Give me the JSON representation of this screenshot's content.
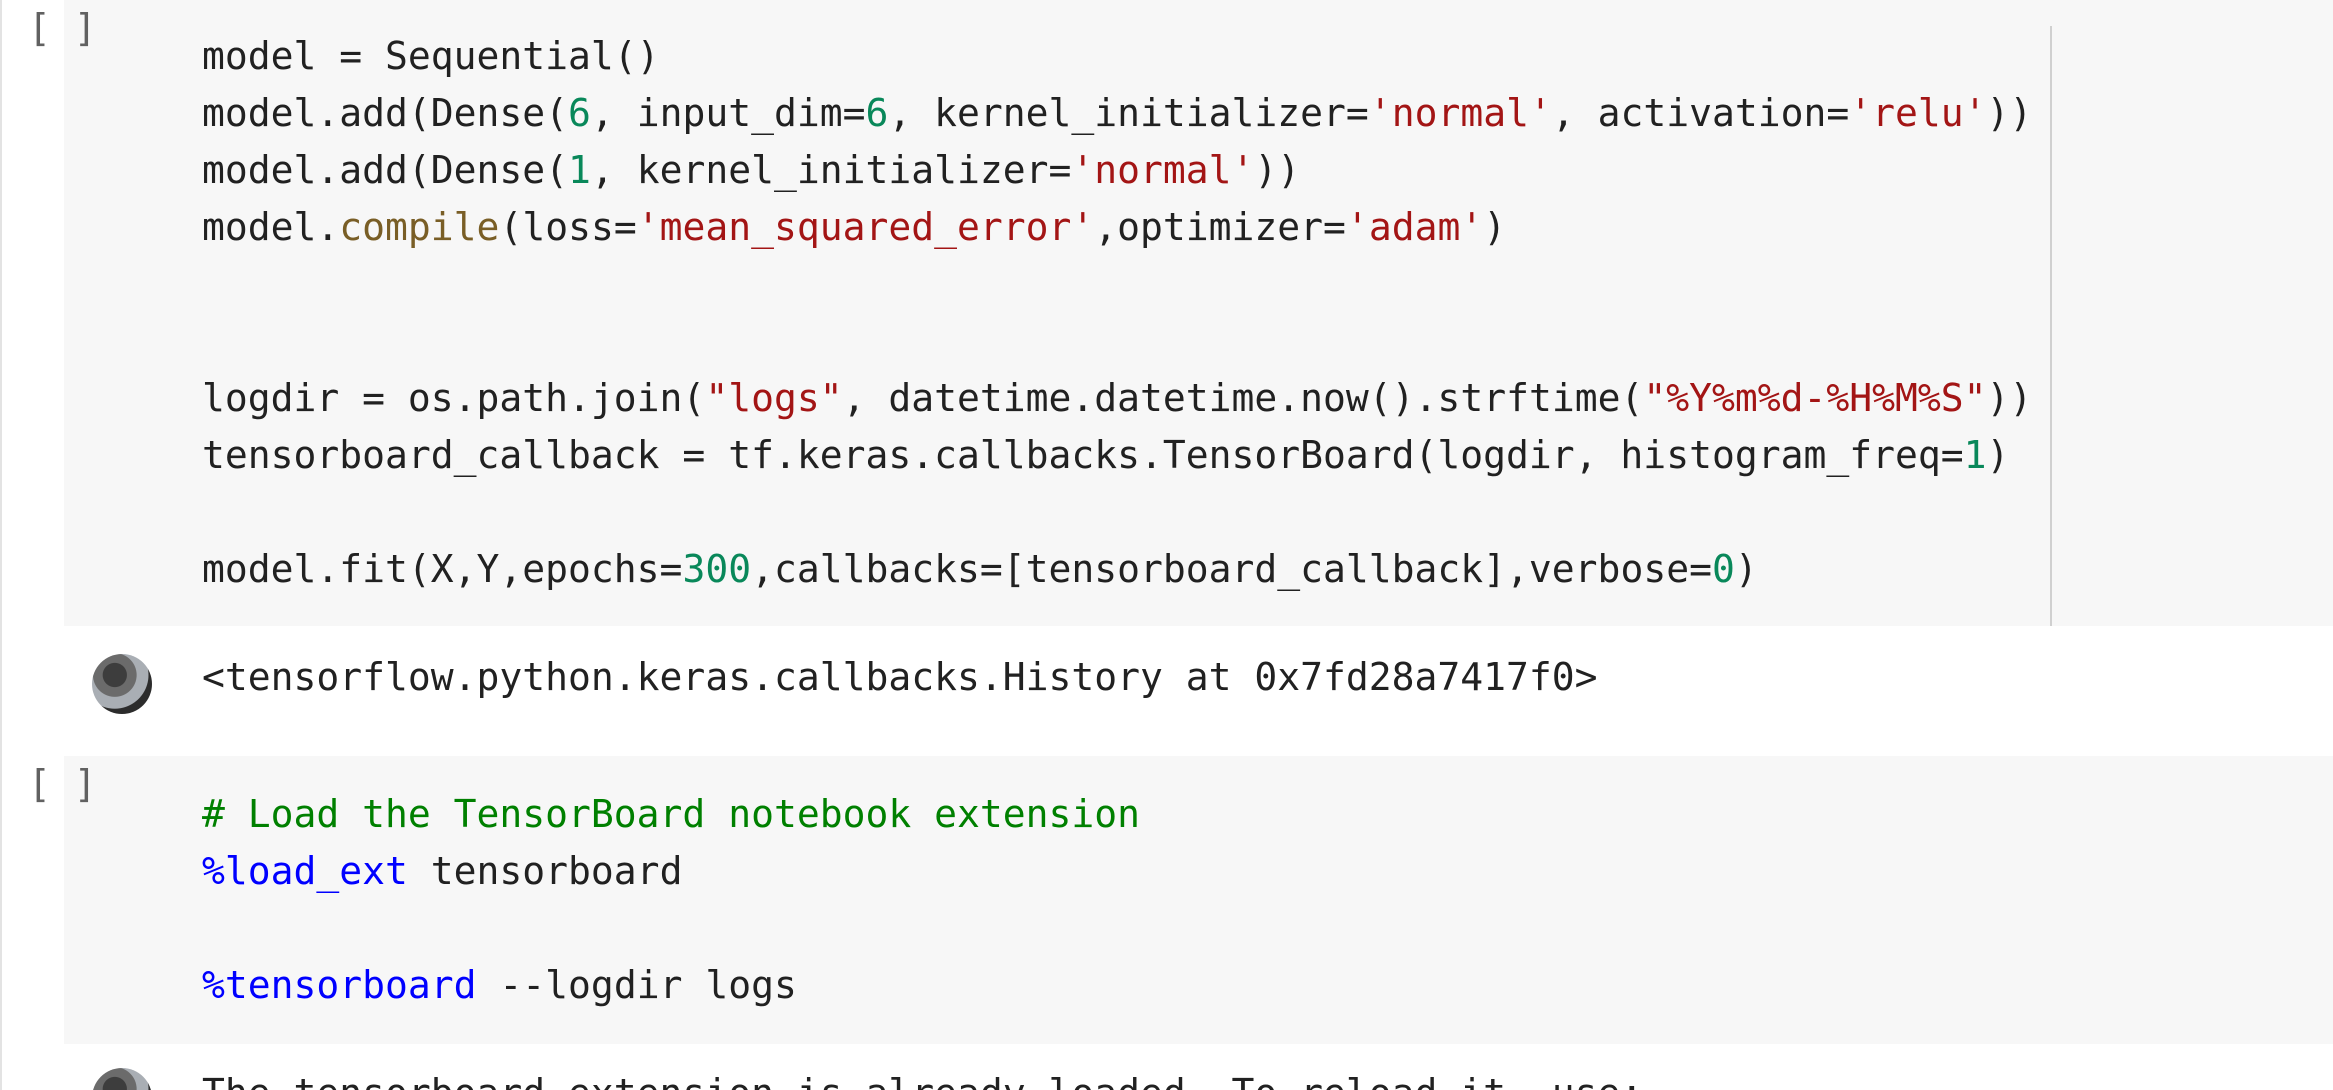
{
  "left_rule": true,
  "cells": [
    {
      "run_label": "[ ]",
      "lines": [
        [
          {
            "text": "model = Sequential()",
            "kind": "default"
          }
        ],
        [
          {
            "text": "model.add(Dense(",
            "kind": "default"
          },
          {
            "text": "6",
            "kind": "number"
          },
          {
            "text": ", input_dim=",
            "kind": "default"
          },
          {
            "text": "6",
            "kind": "number"
          },
          {
            "text": ", kernel_initializer=",
            "kind": "default"
          },
          {
            "text": "'normal'",
            "kind": "string"
          },
          {
            "text": ", activation=",
            "kind": "default"
          },
          {
            "text": "'relu'",
            "kind": "string"
          },
          {
            "text": "))",
            "kind": "default"
          }
        ],
        [
          {
            "text": "model.add(Dense(",
            "kind": "default"
          },
          {
            "text": "1",
            "kind": "number"
          },
          {
            "text": ", kernel_initializer=",
            "kind": "default"
          },
          {
            "text": "'normal'",
            "kind": "string"
          },
          {
            "text": "))",
            "kind": "default"
          }
        ],
        [
          {
            "text": "model.",
            "kind": "default"
          },
          {
            "text": "compile",
            "kind": "builtin"
          },
          {
            "text": "(loss=",
            "kind": "default"
          },
          {
            "text": "'mean_squared_error'",
            "kind": "string"
          },
          {
            "text": ",optimizer=",
            "kind": "default"
          },
          {
            "text": "'adam'",
            "kind": "string"
          },
          {
            "text": ")",
            "kind": "default"
          }
        ],
        [],
        [],
        [
          {
            "text": "logdir = os.path.join(",
            "kind": "default"
          },
          {
            "text": "\"logs\"",
            "kind": "string"
          },
          {
            "text": ", datetime.datetime.now().strftime(",
            "kind": "default"
          },
          {
            "text": "\"%Y%m%d-%H%M%S\"",
            "kind": "string"
          },
          {
            "text": "))",
            "kind": "default"
          }
        ],
        [
          {
            "text": "tensorboard_callback = tf.keras.callbacks.TensorBoard(logdir, histogram_freq=",
            "kind": "default"
          },
          {
            "text": "1",
            "kind": "number"
          },
          {
            "text": ")",
            "kind": "default"
          }
        ],
        [],
        [
          {
            "text": "model.fit(X,Y,epochs=",
            "kind": "default"
          },
          {
            "text": "300",
            "kind": "number"
          },
          {
            "text": ",callbacks=[tensorboard_callback],verbose=",
            "kind": "default"
          },
          {
            "text": "0",
            "kind": "number"
          },
          {
            "text": ")",
            "kind": "default"
          }
        ]
      ],
      "output": "<tensorflow.python.keras.callbacks.History at 0x7fd28a7417f0>"
    },
    {
      "run_label": "[ ]",
      "lines": [
        [
          {
            "text": "# Load the TensorBoard notebook extension",
            "kind": "comment"
          }
        ],
        [
          {
            "text": "%load_ext",
            "kind": "magic"
          },
          {
            "text": " tensorboard",
            "kind": "default"
          }
        ],
        [],
        [
          {
            "text": "%tensorboard",
            "kind": "magic"
          },
          {
            "text": " --logdir logs",
            "kind": "default"
          }
        ]
      ],
      "output": "The tensorboard extension is already loaded. To reload it, use:"
    }
  ],
  "colors": {
    "cell_background": "#f7f7f7",
    "string": "#a31515",
    "number": "#09885a",
    "builtin": "#795e26",
    "comment": "#008000",
    "magic": "#0000ff",
    "default": "#212121"
  }
}
